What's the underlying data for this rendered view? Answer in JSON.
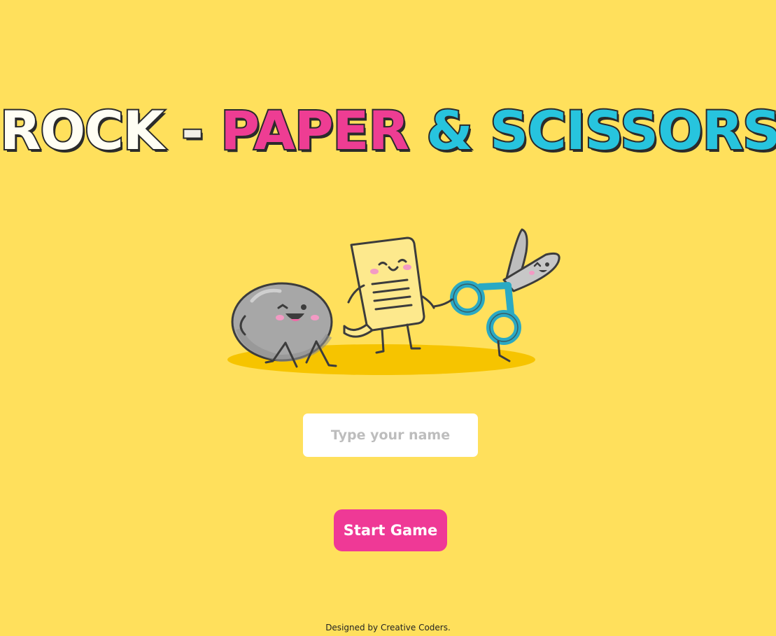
{
  "title": {
    "word_rock": "ROCK",
    "word_dash": "-",
    "word_paper": "PAPER",
    "word_amp": "&",
    "word_scissors": "SCISSORS"
  },
  "colors": {
    "background": "#ffe05c",
    "paper_pink": "#ee3d93",
    "scissors_blue": "#27c4de",
    "button_pink": "#ef3996",
    "outline": "#2b2b2b"
  },
  "illustration": {
    "characters": [
      "rock-character",
      "paper-character",
      "scissors-character"
    ]
  },
  "name_input": {
    "placeholder": "Type your name",
    "value": ""
  },
  "start_button": {
    "label": "Start Game"
  },
  "footer": {
    "text": "Designed by Creative Coders."
  }
}
